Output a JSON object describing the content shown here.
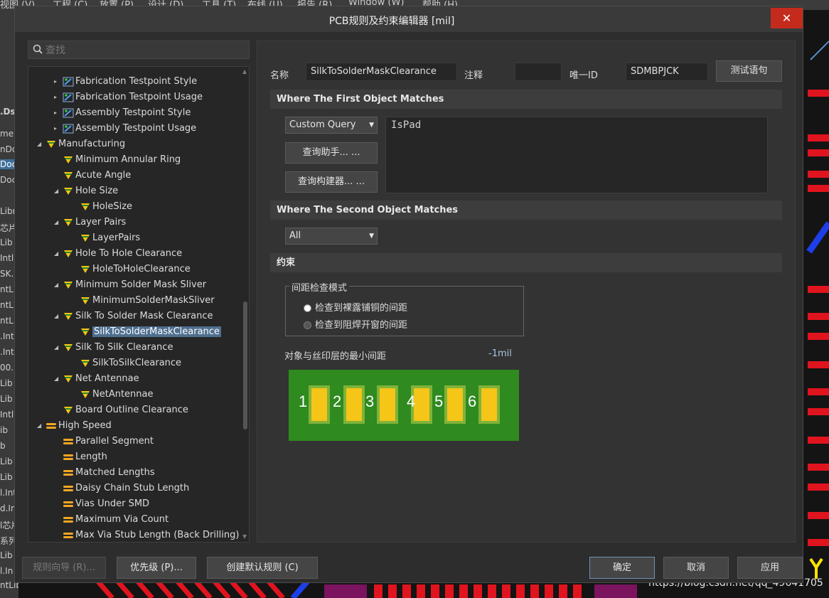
{
  "background_app": {
    "menu": [
      "视图 (V)",
      "工程 (C)",
      "放置 (P)",
      "设计 (D)",
      "工具 (T)",
      "布线 (U)",
      "报告 (R)",
      "Window (W)",
      "帮助 (H)"
    ],
    "left_fragments": [
      "me",
      "nDo",
      "Doc",
      "Doc",
      "Libr",
      "芯片",
      "Lib",
      "Intl",
      "SK.I",
      "ntL",
      "ntL",
      "ntL",
      ".Int",
      ".Int",
      "00.",
      "Lib",
      "Lib",
      "Intl",
      "ib",
      "b",
      "Lib",
      "Lib",
      "l.Int",
      "d.Ir",
      "l芯片",
      "系列",
      "Lib",
      "l.In",
      "ntLib"
    ],
    "left_header": ".Ds",
    "watermark": "https://blog.csdn.net/qq_49641705"
  },
  "dialog": {
    "title": "PCB规则及约束编辑器 [mil]",
    "close_label": "✕",
    "search_placeholder": "查找"
  },
  "tree": [
    {
      "label": "Fabrication Testpoint Style",
      "level": 2,
      "expander": "▸",
      "icon": "testpoint-icon"
    },
    {
      "label": "Fabrication Testpoint Usage",
      "level": 2,
      "expander": "▸",
      "icon": "testpoint-icon"
    },
    {
      "label": "Assembly Testpoint Style",
      "level": 2,
      "expander": "▸",
      "icon": "testpoint-icon"
    },
    {
      "label": "Assembly Testpoint Usage",
      "level": 2,
      "expander": "▸",
      "icon": "testpoint-icon"
    },
    {
      "label": "Manufacturing",
      "level": 1,
      "expander": "◢",
      "icon": "rule-icon"
    },
    {
      "label": "Minimum Annular Ring",
      "level": 2,
      "expander": "",
      "icon": "rule-icon"
    },
    {
      "label": "Acute Angle",
      "level": 2,
      "expander": "",
      "icon": "rule-icon"
    },
    {
      "label": "Hole Size",
      "level": 2,
      "expander": "◢",
      "icon": "rule-icon"
    },
    {
      "label": "HoleSize",
      "level": 3,
      "expander": "",
      "icon": "rule-icon"
    },
    {
      "label": "Layer Pairs",
      "level": 2,
      "expander": "◢",
      "icon": "rule-icon"
    },
    {
      "label": "LayerPairs",
      "level": 3,
      "expander": "",
      "icon": "rule-icon"
    },
    {
      "label": "Hole To Hole Clearance",
      "level": 2,
      "expander": "◢",
      "icon": "rule-icon"
    },
    {
      "label": "HoleToHoleClearance",
      "level": 3,
      "expander": "",
      "icon": "rule-icon"
    },
    {
      "label": "Minimum Solder Mask Sliver",
      "level": 2,
      "expander": "◢",
      "icon": "rule-icon"
    },
    {
      "label": "MinimumSolderMaskSliver",
      "level": 3,
      "expander": "",
      "icon": "rule-icon"
    },
    {
      "label": "Silk To Solder Mask Clearance",
      "level": 2,
      "expander": "◢",
      "icon": "rule-icon"
    },
    {
      "label": "SilkToSolderMaskClearance",
      "level": 3,
      "expander": "",
      "icon": "rule-icon",
      "selected": true
    },
    {
      "label": "Silk To Silk Clearance",
      "level": 2,
      "expander": "◢",
      "icon": "rule-icon"
    },
    {
      "label": "SilkToSilkClearance",
      "level": 3,
      "expander": "",
      "icon": "rule-icon"
    },
    {
      "label": "Net Antennae",
      "level": 2,
      "expander": "◢",
      "icon": "rule-icon"
    },
    {
      "label": "NetAntennae",
      "level": 3,
      "expander": "",
      "icon": "rule-icon"
    },
    {
      "label": "Board Outline Clearance",
      "level": 2,
      "expander": "",
      "icon": "rule-icon"
    },
    {
      "label": "High Speed",
      "level": 1,
      "expander": "◢",
      "icon": "highspeed-icon"
    },
    {
      "label": "Parallel Segment",
      "level": 2,
      "expander": "",
      "icon": "highspeed-icon"
    },
    {
      "label": "Length",
      "level": 2,
      "expander": "",
      "icon": "highspeed-icon"
    },
    {
      "label": "Matched Lengths",
      "level": 2,
      "expander": "",
      "icon": "highspeed-icon"
    },
    {
      "label": "Daisy Chain Stub Length",
      "level": 2,
      "expander": "",
      "icon": "highspeed-icon"
    },
    {
      "label": "Vias Under SMD",
      "level": 2,
      "expander": "",
      "icon": "highspeed-icon"
    },
    {
      "label": "Maximum Via Count",
      "level": 2,
      "expander": "",
      "icon": "highspeed-icon"
    },
    {
      "label": "Max Via Stub Length (Back Drilling)",
      "level": 2,
      "expander": "",
      "icon": "highspeed-icon"
    }
  ],
  "rule": {
    "name_label": "名称",
    "name_value": "SilkToSolderMaskClearance",
    "comment_label": "注释",
    "comment_value": "",
    "uid_label": "唯一ID",
    "uid_value": "SDMBPJCK",
    "test_button": "测试语句"
  },
  "first_match": {
    "header": "Where The First Object Matches",
    "combo_value": "Custom Query",
    "query_helper_button": "查询助手... ...",
    "query_builder_button": "查询构建器... ...",
    "query_text": "IsPad"
  },
  "second_match": {
    "header": "Where The Second Object Matches",
    "combo_value": "All"
  },
  "constraints": {
    "header": "约束",
    "mode_group_label": "间距检查模式",
    "options": [
      {
        "label": "检查到裸露铺铜的间距",
        "checked": true
      },
      {
        "label": "检查到阻焊开窗的间距",
        "checked": false
      }
    ],
    "min_clearance_label": "对象与丝印层的最小间距",
    "min_clearance_value": "-1mil",
    "pad_numbers": [
      "1",
      "2",
      "3",
      "4",
      "5",
      "6"
    ],
    "colors": {
      "board": "#2f8a1f",
      "pad": "#f5c518",
      "pad_outline": "#7fb33a"
    }
  },
  "footer": {
    "rule_wizard": "规则向导 (R)...",
    "priority": "优先级 (P)...",
    "create_defaults": "创建默认规则 (C)",
    "ok": "确定",
    "cancel": "取消",
    "apply": "应用"
  }
}
